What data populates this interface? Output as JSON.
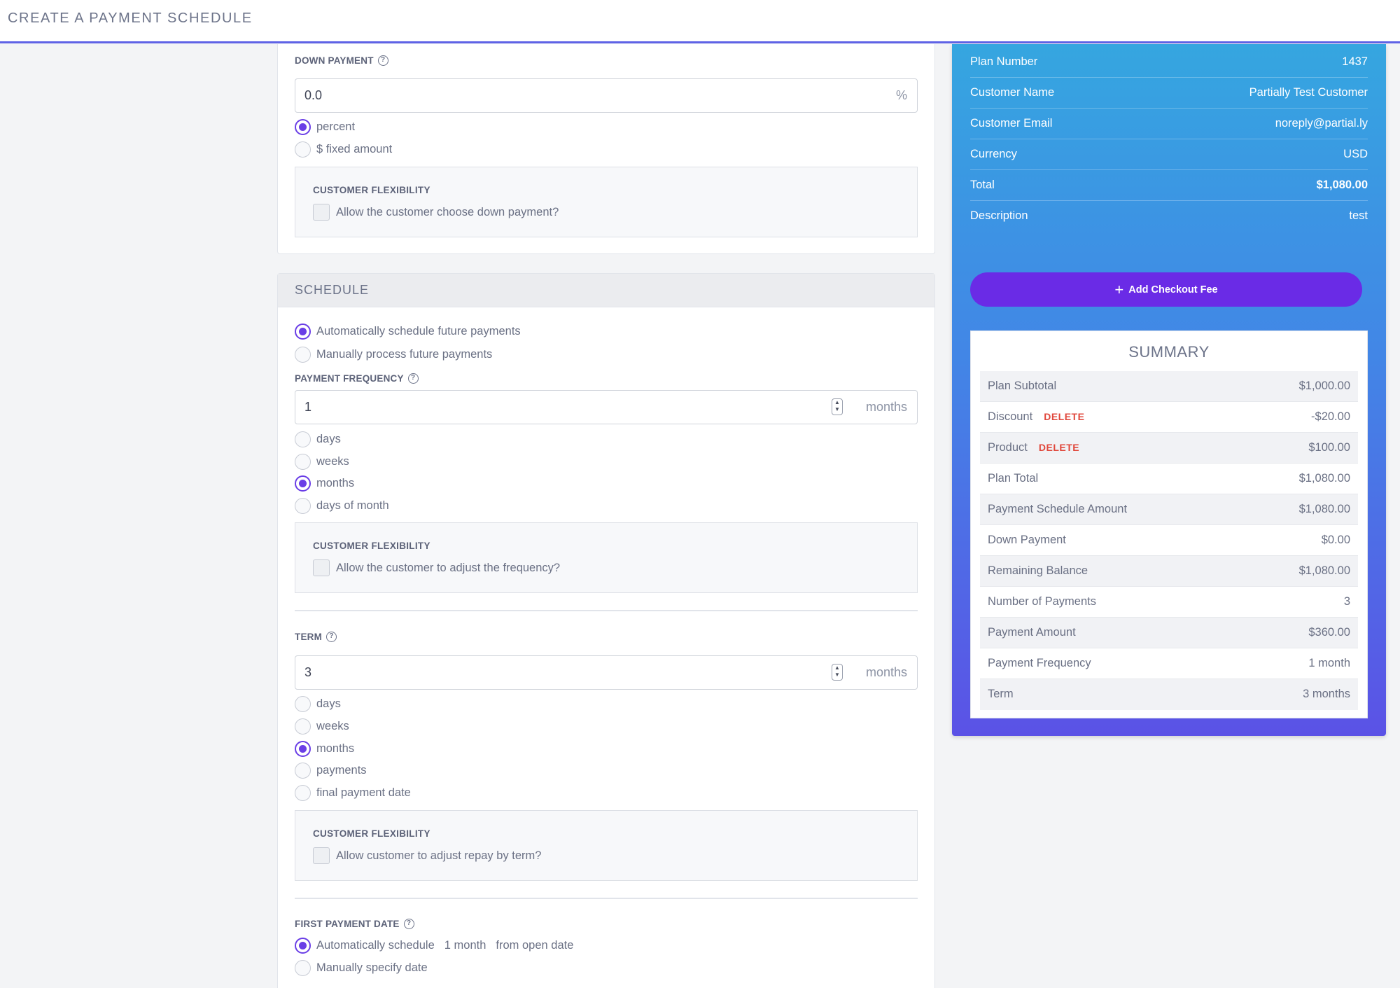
{
  "header": {
    "title": "CREATE A PAYMENT SCHEDULE"
  },
  "down_payment": {
    "label": "DOWN PAYMENT",
    "value": "0.0",
    "suffix": "%",
    "options": [
      "percent",
      "$ fixed amount"
    ],
    "selected": "percent",
    "flex_title": "CUSTOMER FLEXIBILITY",
    "flex_check": "Allow the customer choose down payment?"
  },
  "schedule": {
    "header": "SCHEDULE",
    "mode_options": [
      "Automatically schedule future payments",
      "Manually process future payments"
    ],
    "mode_selected": "Automatically schedule future payments",
    "frequency": {
      "label": "PAYMENT FREQUENCY",
      "value": "1",
      "suffix": "months",
      "options": [
        "days",
        "weeks",
        "months",
        "days of month"
      ],
      "selected": "months",
      "flex_title": "CUSTOMER FLEXIBILITY",
      "flex_check": "Allow the customer to adjust the frequency?"
    },
    "term": {
      "label": "TERM",
      "value": "3",
      "suffix": "months",
      "options": [
        "days",
        "weeks",
        "months",
        "payments",
        "final payment date"
      ],
      "selected": "months",
      "flex_title": "CUSTOMER FLEXIBILITY",
      "flex_check": "Allow customer to adjust repay by term?"
    },
    "first_payment": {
      "label": "FIRST PAYMENT DATE",
      "auto_prefix": "Automatically schedule",
      "auto_value": "1 month",
      "auto_suffix": "from open date",
      "manual_label": "Manually specify date",
      "selected": "auto"
    }
  },
  "plan_info": [
    {
      "key": "Plan Number",
      "value": "1437"
    },
    {
      "key": "Customer Name",
      "value": "Partially Test Customer"
    },
    {
      "key": "Customer Email",
      "value": "noreply@partial.ly"
    },
    {
      "key": "Currency",
      "value": "USD"
    },
    {
      "key": "Total",
      "value": "$1,080.00"
    },
    {
      "key": "Description",
      "value": "test"
    }
  ],
  "checkout_fee_button": "Add Checkout Fee",
  "summary": {
    "title": "SUMMARY",
    "delete_label": "DELETE",
    "rows": [
      {
        "key": "Plan Subtotal",
        "value": "$1,000.00"
      },
      {
        "key": "Discount",
        "value": "-$20.00"
      },
      {
        "key": "Product",
        "value": "$100.00"
      },
      {
        "key": "Plan Total",
        "value": "$1,080.00"
      },
      {
        "key": "Payment Schedule Amount",
        "value": "$1,080.00"
      },
      {
        "key": "Down Payment",
        "value": "$0.00"
      },
      {
        "key": "Remaining Balance",
        "value": "$1,080.00"
      },
      {
        "key": "Number of Payments",
        "value": "3"
      },
      {
        "key": "Payment Amount",
        "value": "$360.00"
      },
      {
        "key": "Payment Frequency",
        "value": "1 month"
      },
      {
        "key": "Term",
        "value": "3 months"
      }
    ]
  },
  "colors": {
    "accent": "#6a2be6",
    "radio": "#6a3ee6",
    "panel_top": "#35a6e0",
    "panel_bottom": "#5b52e6",
    "delete": "#e0473b"
  }
}
